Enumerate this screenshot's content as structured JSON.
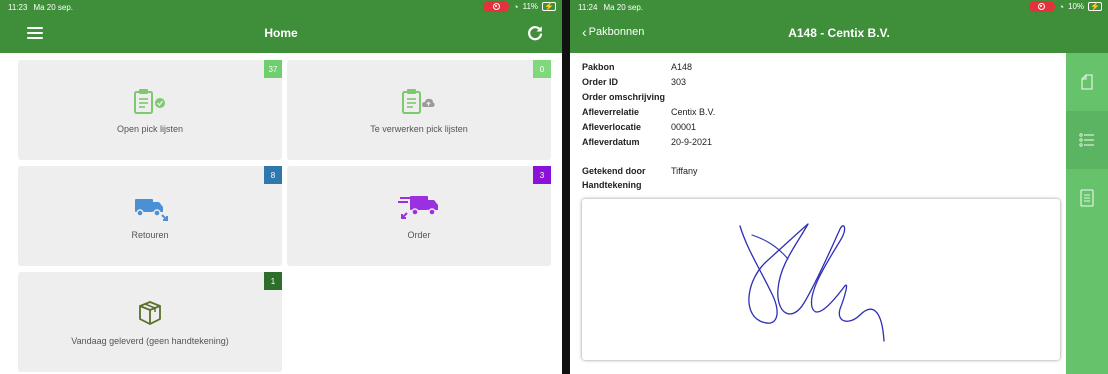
{
  "left": {
    "status": {
      "time": "11:23",
      "date": "Ma 20 sep.",
      "battery": "11%"
    },
    "title": "Home",
    "tiles": [
      {
        "label": "Open pick lijsten",
        "count": "37",
        "badge_color": "#6fcf6f"
      },
      {
        "label": "Te verwerken pick lijsten",
        "count": "0",
        "badge_color": "#7fd97a"
      },
      {
        "label": "Retouren",
        "count": "8",
        "badge_color": "#2f78ad"
      },
      {
        "label": "Order",
        "count": "3",
        "badge_color": "#8a12d6"
      },
      {
        "label": "Vandaag geleverd (geen handtekening)",
        "count": "1",
        "badge_color": "#2e6e2b"
      }
    ]
  },
  "right": {
    "status": {
      "time": "11:24",
      "date": "Ma 20 sep.",
      "battery": "10%"
    },
    "back_label": "Pakbonnen",
    "title": "A148 - Centix B.V.",
    "fields": [
      {
        "key": "Pakbon",
        "value": "A148"
      },
      {
        "key": "Order ID",
        "value": "303"
      },
      {
        "key": "Order omschrijving",
        "value": ""
      },
      {
        "key": "Afleverrelatie",
        "value": "Centix B.V."
      },
      {
        "key": "Afleverlocatie",
        "value": "00001"
      },
      {
        "key": "Afleverdatum",
        "value": "20-9-2021"
      }
    ],
    "signed_by": {
      "key": "Getekend door",
      "value": "Tiffany"
    },
    "signature_label": "Handtekening"
  },
  "colors": {
    "header_green": "#3f8f3a",
    "sidebar_green": "#67c26c",
    "tile_bg": "#eeeeee",
    "signature_ink": "#2f2fb5"
  }
}
